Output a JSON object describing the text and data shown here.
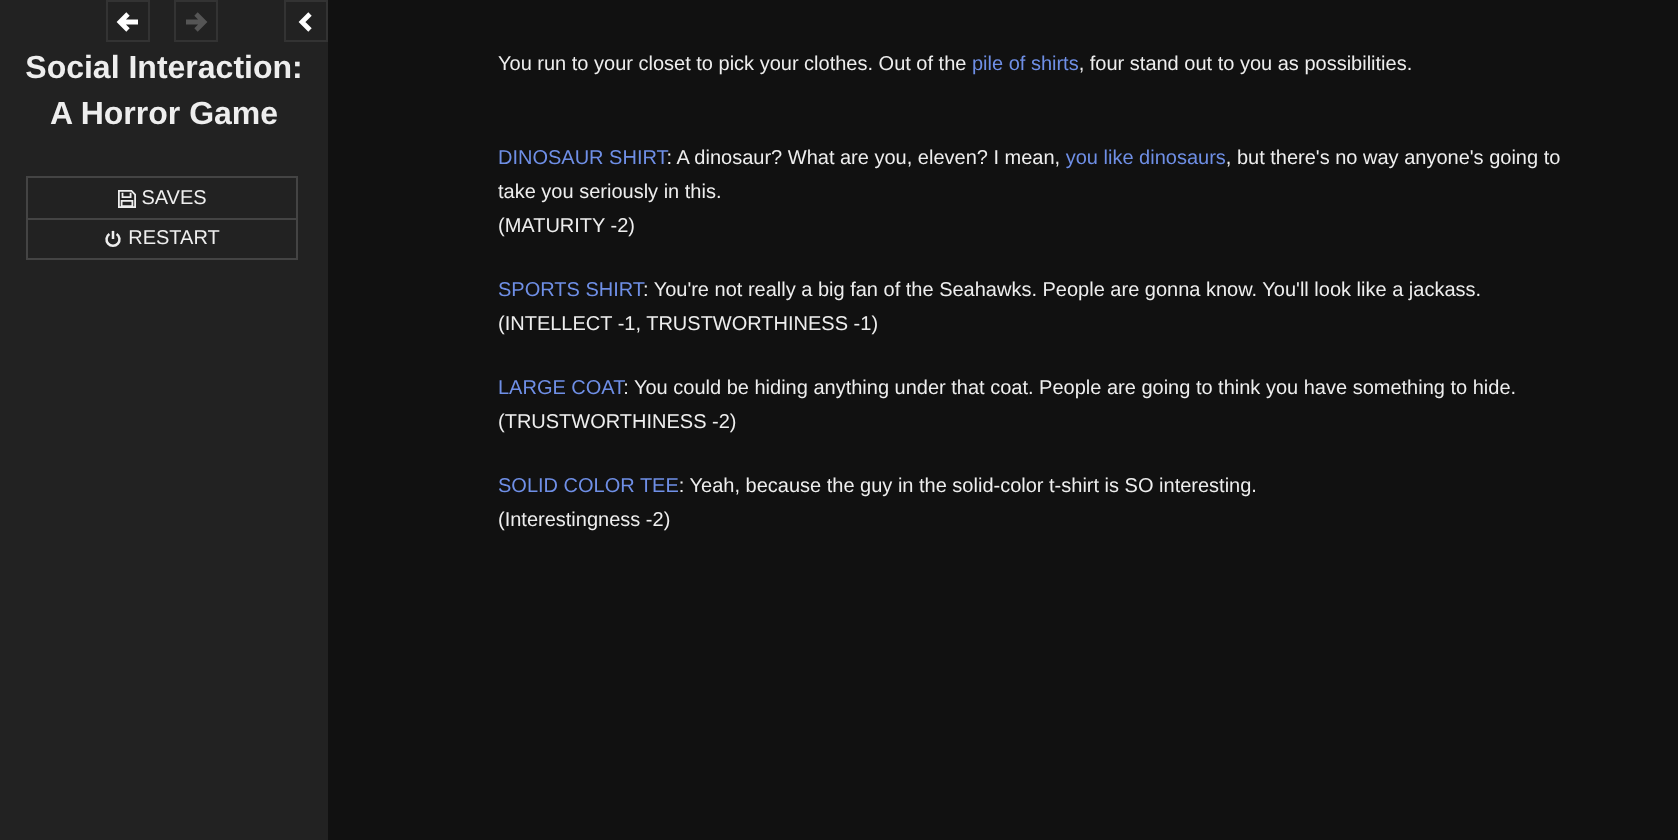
{
  "sidebar": {
    "nav": [
      {
        "kind": "back",
        "disabled": false
      },
      {
        "kind": "forward",
        "disabled": true
      }
    ],
    "title_lines": [
      "Social Interaction:",
      "A Horror Game"
    ],
    "menu": [
      {
        "kind": "saves",
        "label": "SAVES"
      },
      {
        "kind": "restart",
        "label": "RESTART"
      }
    ]
  },
  "passage": {
    "intro": [
      {
        "kind": "text",
        "text": "You run to your closet to pick your clothes. Out of the "
      },
      {
        "kind": "link",
        "text": "pile of shirts"
      },
      {
        "kind": "text",
        "text": ", four stand out to you as possibilities."
      }
    ],
    "options": [
      {
        "segments": [
          {
            "kind": "link",
            "text": "DINOSAUR SHIRT"
          },
          {
            "kind": "text",
            "text": ": A dinosaur? What are you, eleven? I mean, "
          },
          {
            "kind": "link",
            "text": "you like dinosaurs"
          },
          {
            "kind": "text",
            "text": ", but there's no way anyone's going to take you seriously in this."
          }
        ],
        "effect": "(MATURITY -2)"
      },
      {
        "segments": [
          {
            "kind": "link",
            "text": "SPORTS SHIRT"
          },
          {
            "kind": "text",
            "text": ": You're not really a big fan of the Seahawks. People are gonna know. You'll look like a jackass."
          }
        ],
        "effect": "(INTELLECT -1, TRUSTWORTHINESS -1)"
      },
      {
        "segments": [
          {
            "kind": "link",
            "text": "LARGE COAT"
          },
          {
            "kind": "text",
            "text": ": You could be hiding anything under that coat. People are going to think you have something to hide."
          }
        ],
        "effect": "(TRUSTWORTHINESS -2)"
      },
      {
        "segments": [
          {
            "kind": "link",
            "text": "SOLID COLOR TEE"
          },
          {
            "kind": "text",
            "text": ": Yeah, because the guy in the solid-color t-shirt is SO interesting."
          }
        ],
        "effect": "(Interestingness -2)"
      }
    ]
  }
}
